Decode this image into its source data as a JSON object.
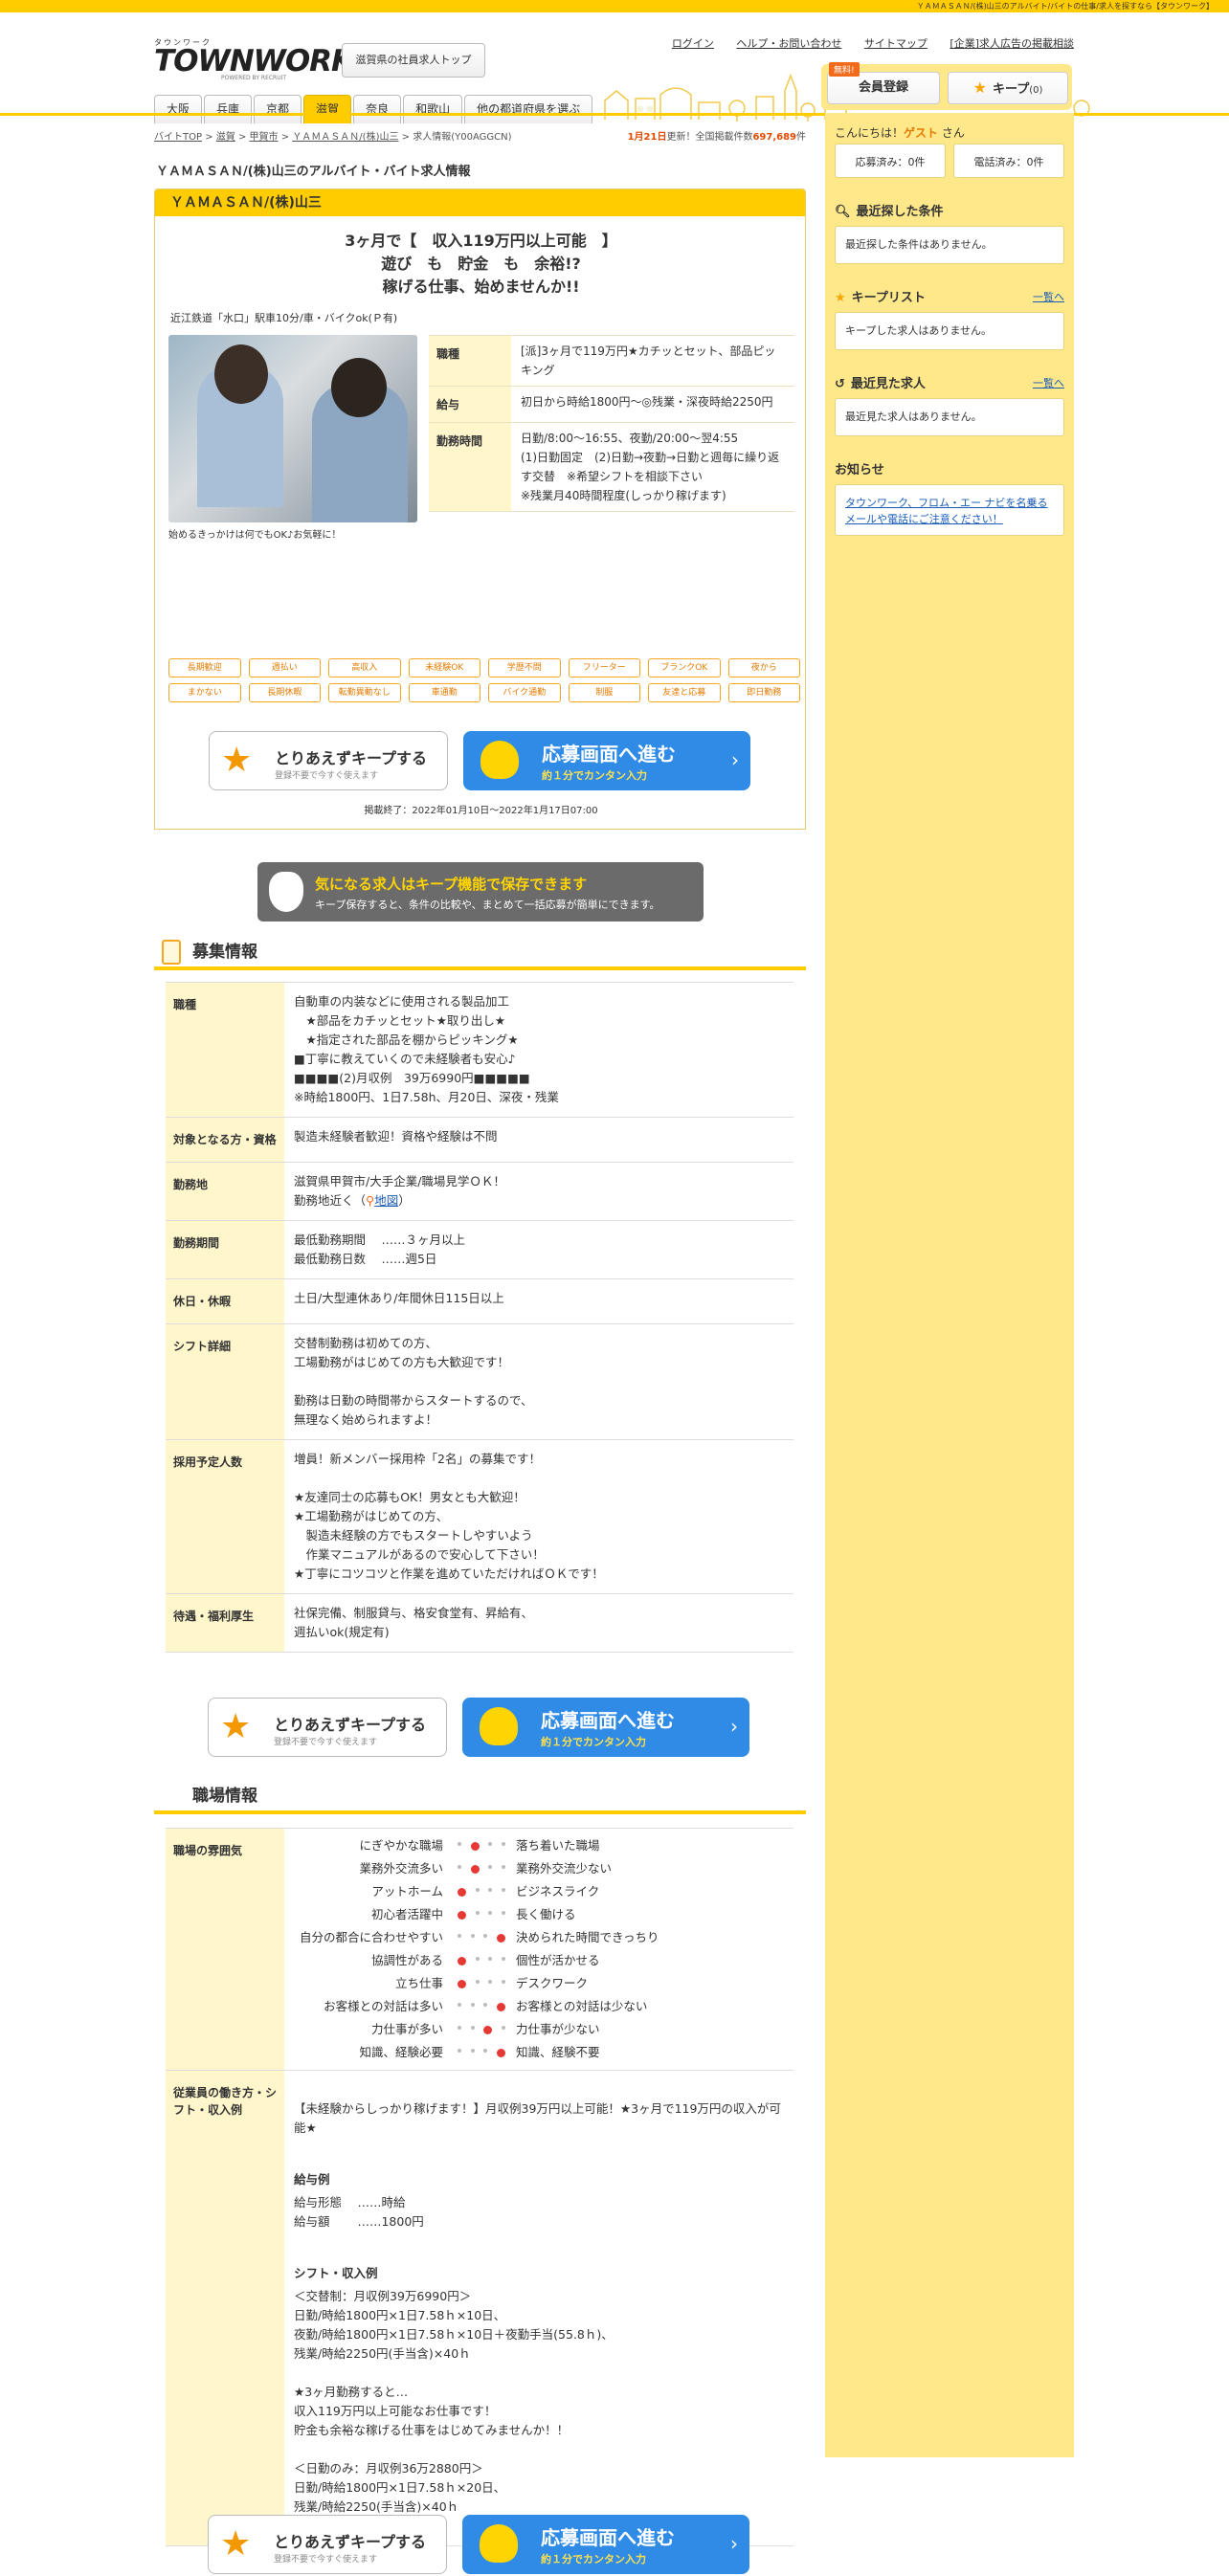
{
  "topbar": {
    "text": "ＹＡＭＡＳＡＮ/(株)山三のアルバイト/バイトの仕事/求人を探すなら【タウンワーク】"
  },
  "header": {
    "logo_kana": "タウンワーク",
    "logo_text": "TOWNWORK",
    "logo_by": "POWERED BY RECRUIT",
    "pref_top_button": "滋賀県の社員求人トップ",
    "links": [
      "ログイン",
      "ヘルプ・お問い合わせ",
      "サイトマップ",
      "[企業]求人広告の掲載相談"
    ],
    "pref_tabs": [
      "大阪",
      "兵庫",
      "京都",
      "滋賀",
      "奈良",
      "和歌山",
      "他の都道府県を選ぶ"
    ],
    "active_tab": "滋賀",
    "free_badge": "無料!",
    "member_button": "会員登録",
    "keep_button": "キープ",
    "keep_count": "(0)"
  },
  "breadcrumb": {
    "items": [
      "バイトTOP",
      "滋賀",
      "甲賀市",
      "ＹＡＭＡＳＡＮ/(株)山三",
      "求人情報(Y00AGGCN)"
    ],
    "sep": ">",
    "update_date": "1月21日",
    "update_text_1": "更新！全国掲載件数",
    "update_count": "697,689",
    "update_text_2": "件"
  },
  "page_title": "ＹＡＭＡＳＡＮ/(株)山三のアルバイト・バイト求人情報",
  "job": {
    "company": "ＹＡＭＡＳＡＮ/(株)山三",
    "catch": [
      "3ヶ月で【　収入119万円以上可能　】",
      "遊び　も　貯金　も　余裕!?",
      "稼げる仕事、始めませんか!!"
    ],
    "station": "近江鉄道「水口」駅車10分/車・バイクok(Ｐ有)",
    "photo_caption": "始めるきっかけは何でもOK♪お気軽に！",
    "summary": [
      {
        "label": "職種",
        "value": "[派]3ヶ月で119万円★カチッとセット、部品ピッキング"
      },
      {
        "label": "給与",
        "value": "初日から時給1800円～◎残業・深夜時給2250円"
      },
      {
        "label": "勤務時間",
        "value": "日勤/8:00～16:55、夜勤/20:00～翌4:55\n(1)日勤固定　(2)日勤→夜勤→日勤と週毎に繰り返す交替　※希望シフトを相談下さい\n※残業月40時間程度(しっかり稼げます)"
      }
    ],
    "tags": [
      "長期歓迎",
      "週払い",
      "高収入",
      "未経験OK",
      "学歴不問",
      "フリーター",
      "ブランクOK",
      "夜から",
      "まかない",
      "長期休暇",
      "転勤異動なし",
      "車通勤",
      "バイク通勤",
      "制服",
      "友達と応募",
      "即日勤務"
    ],
    "period": "掲載終了：2022年01月10日～2022年1月17日07:00"
  },
  "actions": {
    "keep_title": "とりあえずキープする",
    "keep_sub": "登録不要で今すぐ使えます",
    "apply_title": "応募画面へ進む",
    "apply_sub": "約１分でカンタン入力",
    "arrow": "›"
  },
  "keep_banner": {
    "title": "気になる求人はキープ機能で保存できます",
    "sub": "キープ保存すると、条件の比較や、まとめて一括応募が簡単にできます。"
  },
  "recruit_section": {
    "title": "募集情報",
    "rows": [
      {
        "label": "職種",
        "value": "自動車の内装などに使用される製品加工\n　★部品をカチッとセット★取り出し★\n　★指定された部品を棚からピッキング★\n■丁寧に教えていくので未経験者も安心♪\n■■■■(2)月収例　39万6990円■■■■■\n※時給1800円、1日7.58h、月20日、深夜・残業"
      },
      {
        "label": "対象となる方・資格",
        "value": "製造未経験者歓迎！資格や経験は不問"
      },
      {
        "label": "勤務地",
        "value": "滋賀県甲賀市/大手企業/職場見学ＯＫ！\n勤務地近く"
      },
      {
        "label": "勤務期間",
        "value": "最低勤務期間　 ……３ヶ月以上\n最低勤務日数　 ……週5日"
      },
      {
        "label": "休日・休暇",
        "value": "土日/大型連休あり/年間休日115日以上"
      },
      {
        "label": "シフト詳細",
        "value": "交替制勤務は初めての方、\n工場勤務がはじめての方も大歓迎です！\n\n勤務は日勤の時間帯からスタートするので、\n無理なく始められますよ！"
      },
      {
        "label": "採用予定人数",
        "value": "増員！新メンバー採用枠「2名」の募集です！\n\n★友達同士の応募もOK！男女とも大歓迎！\n★工場勤務がはじめての方、\n　製造未経験の方でもスタートしやすいよう\n　作業マニュアルがあるので安心して下さい！\n★丁寧にコツコツと作業を進めていただければＯＫです！"
      },
      {
        "label": "待遇・福利厚生",
        "value": "社保完備、制服貸与、格安食堂有、昇給有、\n週払いok(規定有)"
      }
    ],
    "map_link": "地図",
    "map_paren_open": "（",
    "map_paren_close": "）"
  },
  "workplace_section": {
    "title": "職場情報",
    "mood_label": "職場の雰囲気",
    "mood": [
      {
        "left": "にぎやかな職場",
        "right": "落ち着いた職場",
        "level": 2
      },
      {
        "left": "業務外交流多い",
        "right": "業務外交流少ない",
        "level": 2
      },
      {
        "left": "アットホーム",
        "right": "ビジネスライク",
        "level": 1
      },
      {
        "left": "初心者活躍中",
        "right": "長く働ける",
        "level": 1
      },
      {
        "left": "自分の都合に合わせやすい",
        "right": "決められた時間できっちり",
        "level": 4
      },
      {
        "left": "協調性がある",
        "right": "個性が活かせる",
        "level": 1
      },
      {
        "left": "立ち仕事",
        "right": "デスクワーク",
        "level": 1
      },
      {
        "left": "お客様との対話は多い",
        "right": "お客様との対話は少ない",
        "level": 4
      },
      {
        "left": "力仕事が多い",
        "right": "力仕事が少ない",
        "level": 3
      },
      {
        "left": "知識、経験必要",
        "right": "知識、経験不要",
        "level": 4
      }
    ],
    "example_label": "従業員の働き方・シフト・収入例",
    "example_intro": "【未経験からしっかり稼げます！】月収例39万円以上可能！★3ヶ月で119万円の収入が可能★",
    "pay_head": "給与例",
    "pay_body": "給与形態　 ……時給\n給与額　　 ……1800円",
    "shift_head": "シフト・収入例",
    "shift_body": "＜交替制：月収例39万6990円＞\n日勤/時給1800円×1日7.58ｈ×10日、\n夜勤/時給1800円×1日7.58ｈ×10日＋夜勤手当(55.8ｈ)、\n残業/時給2250円(手当含)×40ｈ\n\n★3ヶ月勤務すると…\n収入119万円以上可能なお仕事です！\n貯金も余裕な稼げる仕事をはじめてみませんか！！\n\n＜日勤のみ：月収例36万2880円＞\n日勤/時給1800円×1日7.58ｈ×20日、\n残業/時給2250(手当含)×40ｈ"
  },
  "sidebar": {
    "greet_1": "こんにちは！",
    "guest": "ゲスト",
    "greet_2": "さん",
    "applied": "応募済み：0件",
    "called": "電話済み：0件",
    "recent_search_title": "最近探した条件",
    "recent_search_empty": "最近探した条件はありません。",
    "keep_title": "キープリスト",
    "keep_more": "一覧へ",
    "keep_empty": "キープした求人はありません。",
    "recent_view_title": "最近見た求人",
    "recent_view_more": "一覧へ",
    "recent_view_empty": "最近見た求人はありません。",
    "notice_title": "お知らせ",
    "notice_link": "タウンワーク、フロム・エー ナビを名乗るメールや電話にご注意ください！"
  }
}
